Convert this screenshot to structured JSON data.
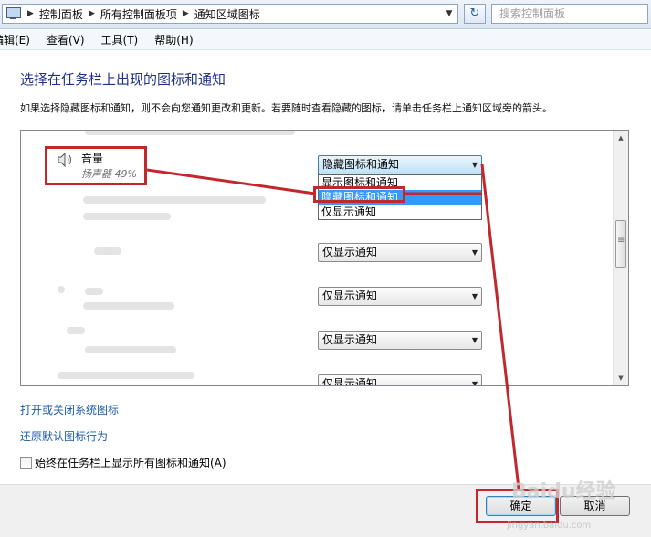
{
  "address_bar": {
    "breadcrumbs": [
      "控制面板",
      "所有控制面板项",
      "通知区域图标"
    ],
    "search_placeholder": "搜索控制面板"
  },
  "menu": [
    "编辑(E)",
    "查看(V)",
    "工具(T)",
    "帮助(H)"
  ],
  "page": {
    "title": "选择在任务栏上出现的图标和通知",
    "description": "如果选择隐藏图标和通知，则不会向您通知更改和更新。若要随时查看隐藏的图标，请单击任务栏上通知区域旁的箭头。"
  },
  "icons_list": {
    "volume_row": {
      "name": "音量",
      "subtitle": "扬声器 49%",
      "selected": "隐藏图标和通知"
    },
    "dropdown_options": [
      "显示图标和通知",
      "隐藏图标和通知",
      "仅显示通知"
    ],
    "highlighted_option": "隐藏图标和通知",
    "other_rows": [
      {
        "selected": "仅显示通知"
      },
      {
        "selected": "仅显示通知"
      },
      {
        "selected": "仅显示通知"
      },
      {
        "selected": "仅显示通知"
      }
    ]
  },
  "links": {
    "system_icons": "打开或关闭系统图标",
    "restore_defaults": "还原默认图标行为"
  },
  "always_show_checkbox": {
    "label": "始终在任务栏上显示所有图标和通知(A)",
    "checked": false
  },
  "buttons": {
    "ok": "确定",
    "cancel": "取消"
  },
  "watermark": {
    "brand": "Baidu经验",
    "url": "jingyan.baidu.com"
  },
  "colors": {
    "annotation": "#c0282e",
    "highlight": "#3399ff",
    "title": "#1e3287",
    "link": "#1b5ba8"
  }
}
